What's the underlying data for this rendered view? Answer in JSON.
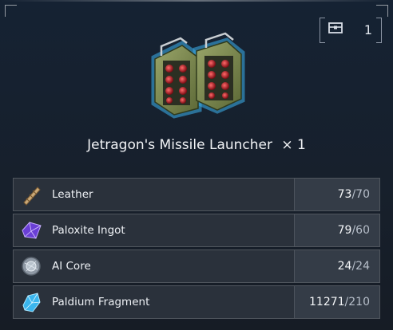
{
  "storage": {
    "icon": "chest-icon",
    "count": "1"
  },
  "item": {
    "icon": "missile-launcher-icon",
    "name": "Jetragon's Missile Launcher",
    "times": "×",
    "quantity": "1"
  },
  "requirements": [
    {
      "icon": "leather-icon",
      "name": "Leather",
      "have": "73",
      "need": "70"
    },
    {
      "icon": "paloxite-ingot-icon",
      "name": "Paloxite Ingot",
      "have": "79",
      "need": "60"
    },
    {
      "icon": "ai-core-icon",
      "name": "AI Core",
      "have": "24",
      "need": "24"
    },
    {
      "icon": "paldium-fragment-icon",
      "name": "Paldium Fragment",
      "have": "11271",
      "need": "210"
    }
  ],
  "separator": "/",
  "colors": {
    "panel": "#17202c",
    "row": "#2a313b",
    "accent_red": "#c0182a"
  }
}
